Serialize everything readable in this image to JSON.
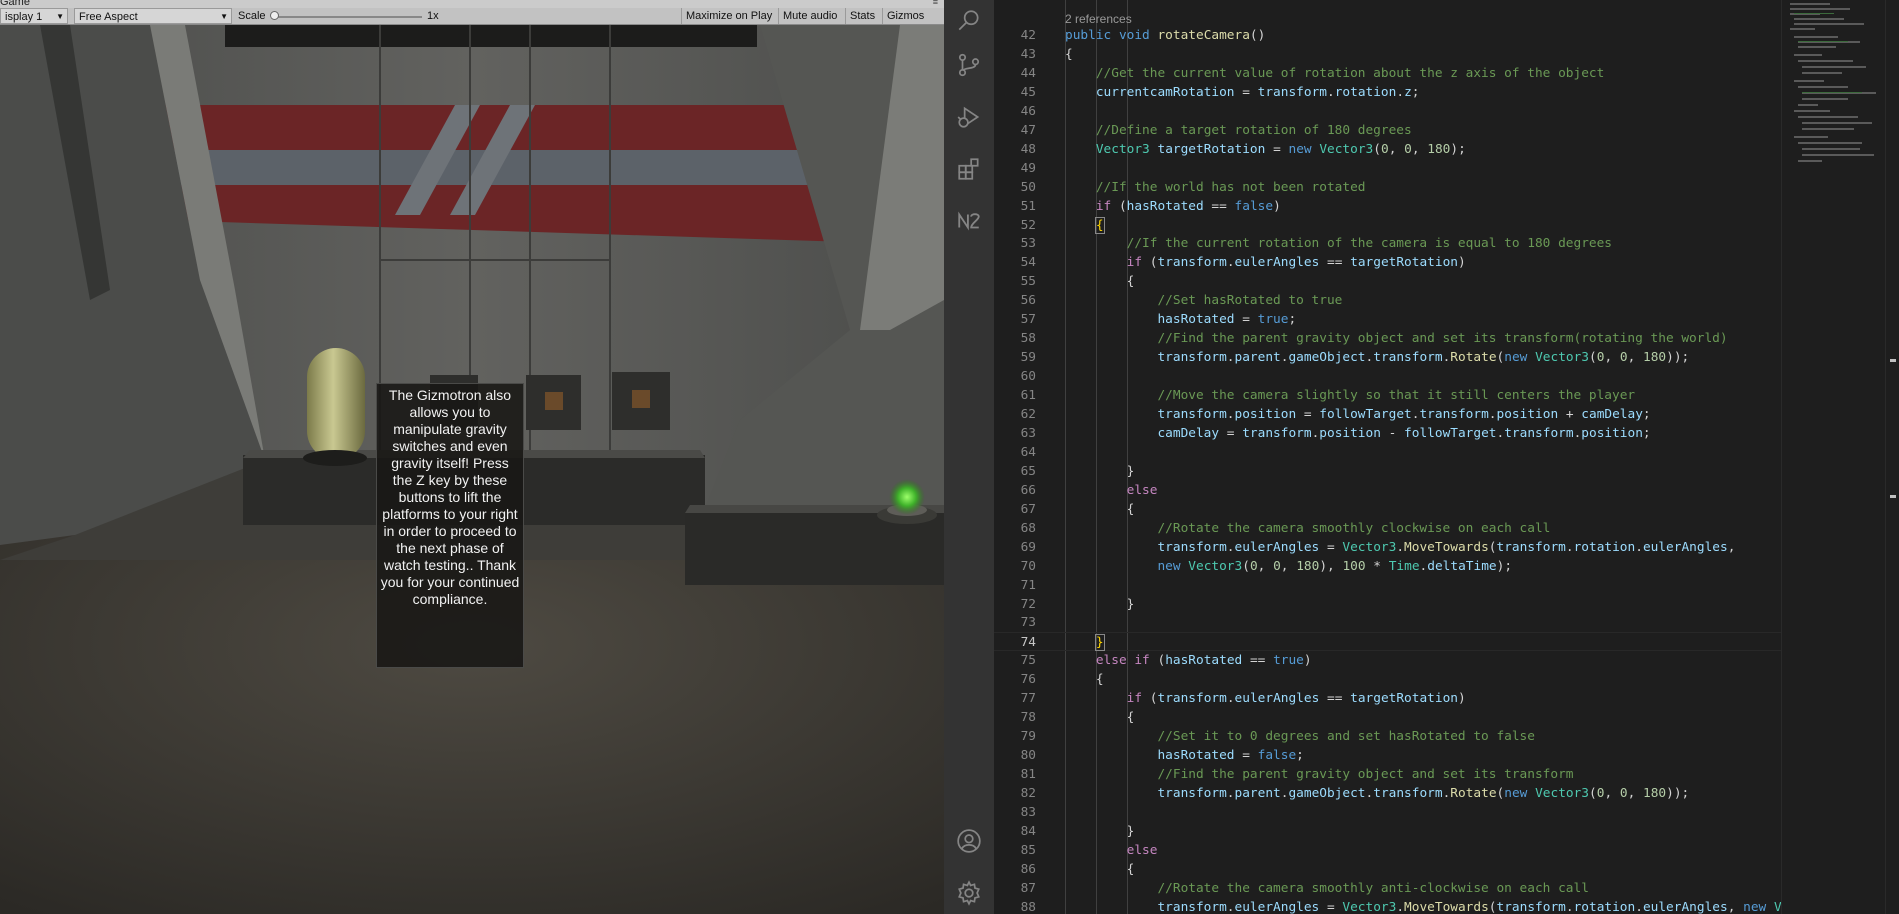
{
  "game_view": {
    "tab_title": "Game",
    "display_label": "isplay 1",
    "aspect_label": "Free Aspect",
    "scale_label": "Scale",
    "scale_value": "1x",
    "scale_level": 0.0,
    "buttons": [
      "Maximize on Play",
      "Mute audio",
      "Stats",
      "Gizmos"
    ],
    "tooltip_text": "The Gizmotron also allows you to manipulate gravity switches and even gravity itself! Press the Z key by these buttons to lift the platforms to your right in order to proceed to the next phase of watch testing.. Thank you for your continued compliance."
  },
  "activity_bar": {
    "icons": [
      "search-icon",
      "source-control-icon",
      "run-debug-icon",
      "extensions-icon",
      "n2-icon",
      "account-icon",
      "settings-gear-icon"
    ]
  },
  "editor": {
    "codelens": "2 references",
    "colors": {
      "comment": "#6a9955",
      "keyword": "#569cd6",
      "control": "#c586c0",
      "type": "#4ec9b0",
      "function": "#dcdcaa",
      "variable": "#9cdcfe",
      "number": "#b5cea8",
      "text": "#d4d4d4"
    },
    "lines": [
      {
        "num": "42",
        "tokens": [
          [
            "keyword",
            "public "
          ],
          [
            "keyword",
            "void "
          ],
          [
            "func",
            "rotateCamera"
          ],
          [
            "plain",
            "()"
          ]
        ]
      },
      {
        "num": "43",
        "tokens": [
          [
            "plain",
            "{"
          ]
        ]
      },
      {
        "num": "44",
        "tokens": [
          [
            "plain",
            "    "
          ],
          [
            "comment",
            "//Get the current value of rotation about the z axis of the object"
          ]
        ]
      },
      {
        "num": "45",
        "tokens": [
          [
            "plain",
            "    "
          ],
          [
            "var",
            "currentcamRotation"
          ],
          [
            "plain",
            " = "
          ],
          [
            "var",
            "transform"
          ],
          [
            "plain",
            "."
          ],
          [
            "var",
            "rotation"
          ],
          [
            "plain",
            "."
          ],
          [
            "var",
            "z"
          ],
          [
            "plain",
            ";"
          ]
        ]
      },
      {
        "num": "46",
        "tokens": []
      },
      {
        "num": "47",
        "tokens": [
          [
            "plain",
            "    "
          ],
          [
            "comment",
            "//Define a target rotation of 180 degrees"
          ]
        ]
      },
      {
        "num": "48",
        "tokens": [
          [
            "plain",
            "    "
          ],
          [
            "type",
            "Vector3"
          ],
          [
            "plain",
            " "
          ],
          [
            "var",
            "targetRotation"
          ],
          [
            "plain",
            " = "
          ],
          [
            "keyword",
            "new "
          ],
          [
            "type",
            "Vector3"
          ],
          [
            "plain",
            "("
          ],
          [
            "num",
            "0"
          ],
          [
            "plain",
            ", "
          ],
          [
            "num",
            "0"
          ],
          [
            "plain",
            ", "
          ],
          [
            "num",
            "180"
          ],
          [
            "plain",
            ");"
          ]
        ]
      },
      {
        "num": "49",
        "tokens": []
      },
      {
        "num": "50",
        "tokens": [
          [
            "plain",
            "    "
          ],
          [
            "comment",
            "//If the world has not been rotated"
          ]
        ]
      },
      {
        "num": "51",
        "tokens": [
          [
            "plain",
            "    "
          ],
          [
            "control",
            "if "
          ],
          [
            "plain",
            "("
          ],
          [
            "var",
            "hasRotated"
          ],
          [
            "plain",
            " == "
          ],
          [
            "keyword",
            "false"
          ],
          [
            "plain",
            ")"
          ]
        ]
      },
      {
        "num": "52",
        "tokens": [
          [
            "plain",
            "    "
          ],
          [
            "bm",
            "{"
          ]
        ]
      },
      {
        "num": "53",
        "tokens": [
          [
            "plain",
            "        "
          ],
          [
            "comment",
            "//If the current rotation of the camera is equal to 180 degrees"
          ]
        ]
      },
      {
        "num": "54",
        "tokens": [
          [
            "plain",
            "        "
          ],
          [
            "control",
            "if "
          ],
          [
            "plain",
            "("
          ],
          [
            "var",
            "transform"
          ],
          [
            "plain",
            "."
          ],
          [
            "var",
            "eulerAngles"
          ],
          [
            "plain",
            " == "
          ],
          [
            "var",
            "targetRotation"
          ],
          [
            "plain",
            ")"
          ]
        ]
      },
      {
        "num": "55",
        "tokens": [
          [
            "plain",
            "        {"
          ]
        ]
      },
      {
        "num": "56",
        "tokens": [
          [
            "plain",
            "            "
          ],
          [
            "comment",
            "//Set hasRotated to true"
          ]
        ]
      },
      {
        "num": "57",
        "tokens": [
          [
            "plain",
            "            "
          ],
          [
            "var",
            "hasRotated"
          ],
          [
            "plain",
            " = "
          ],
          [
            "keyword",
            "true"
          ],
          [
            "plain",
            ";"
          ]
        ]
      },
      {
        "num": "58",
        "tokens": [
          [
            "plain",
            "            "
          ],
          [
            "comment",
            "//Find the parent gravity object and set its transform(rotating the world)"
          ]
        ]
      },
      {
        "num": "59",
        "tokens": [
          [
            "plain",
            "            "
          ],
          [
            "var",
            "transform"
          ],
          [
            "plain",
            "."
          ],
          [
            "var",
            "parent"
          ],
          [
            "plain",
            "."
          ],
          [
            "var",
            "gameObject"
          ],
          [
            "plain",
            "."
          ],
          [
            "var",
            "transform"
          ],
          [
            "plain",
            "."
          ],
          [
            "func",
            "Rotate"
          ],
          [
            "plain",
            "("
          ],
          [
            "keyword",
            "new "
          ],
          [
            "type",
            "Vector3"
          ],
          [
            "plain",
            "("
          ],
          [
            "num",
            "0"
          ],
          [
            "plain",
            ", "
          ],
          [
            "num",
            "0"
          ],
          [
            "plain",
            ", "
          ],
          [
            "num",
            "180"
          ],
          [
            "plain",
            "));"
          ]
        ]
      },
      {
        "num": "60",
        "tokens": []
      },
      {
        "num": "61",
        "tokens": [
          [
            "plain",
            "            "
          ],
          [
            "comment",
            "//Move the camera slightly so that it still centers the player"
          ]
        ]
      },
      {
        "num": "62",
        "tokens": [
          [
            "plain",
            "            "
          ],
          [
            "var",
            "transform"
          ],
          [
            "plain",
            "."
          ],
          [
            "var",
            "position"
          ],
          [
            "plain",
            " = "
          ],
          [
            "var",
            "followTarget"
          ],
          [
            "plain",
            "."
          ],
          [
            "var",
            "transform"
          ],
          [
            "plain",
            "."
          ],
          [
            "var",
            "position"
          ],
          [
            "plain",
            " + "
          ],
          [
            "var",
            "camDelay"
          ],
          [
            "plain",
            ";"
          ]
        ]
      },
      {
        "num": "63",
        "tokens": [
          [
            "plain",
            "            "
          ],
          [
            "var",
            "camDelay"
          ],
          [
            "plain",
            " = "
          ],
          [
            "var",
            "transform"
          ],
          [
            "plain",
            "."
          ],
          [
            "var",
            "position"
          ],
          [
            "plain",
            " - "
          ],
          [
            "var",
            "followTarget"
          ],
          [
            "plain",
            "."
          ],
          [
            "var",
            "transform"
          ],
          [
            "plain",
            "."
          ],
          [
            "var",
            "position"
          ],
          [
            "plain",
            ";"
          ]
        ]
      },
      {
        "num": "64",
        "tokens": []
      },
      {
        "num": "65",
        "tokens": [
          [
            "plain",
            "        }"
          ]
        ]
      },
      {
        "num": "66",
        "tokens": [
          [
            "plain",
            "        "
          ],
          [
            "control",
            "else"
          ]
        ]
      },
      {
        "num": "67",
        "tokens": [
          [
            "plain",
            "        {"
          ]
        ]
      },
      {
        "num": "68",
        "tokens": [
          [
            "plain",
            "            "
          ],
          [
            "comment",
            "//Rotate the camera smoothly clockwise on each call"
          ]
        ]
      },
      {
        "num": "69",
        "tokens": [
          [
            "plain",
            "            "
          ],
          [
            "var",
            "transform"
          ],
          [
            "plain",
            "."
          ],
          [
            "var",
            "eulerAngles"
          ],
          [
            "plain",
            " = "
          ],
          [
            "type",
            "Vector3"
          ],
          [
            "plain",
            "."
          ],
          [
            "func",
            "MoveTowards"
          ],
          [
            "plain",
            "("
          ],
          [
            "var",
            "transform"
          ],
          [
            "plain",
            "."
          ],
          [
            "var",
            "rotation"
          ],
          [
            "plain",
            "."
          ],
          [
            "var",
            "eulerAngles"
          ],
          [
            "plain",
            ","
          ]
        ]
      },
      {
        "num": "70",
        "tokens": [
          [
            "plain",
            "            "
          ],
          [
            "keyword",
            "new "
          ],
          [
            "type",
            "Vector3"
          ],
          [
            "plain",
            "("
          ],
          [
            "num",
            "0"
          ],
          [
            "plain",
            ", "
          ],
          [
            "num",
            "0"
          ],
          [
            "plain",
            ", "
          ],
          [
            "num",
            "180"
          ],
          [
            "plain",
            "), "
          ],
          [
            "num",
            "100"
          ],
          [
            "plain",
            " * "
          ],
          [
            "type",
            "Time"
          ],
          [
            "plain",
            "."
          ],
          [
            "var",
            "deltaTime"
          ],
          [
            "plain",
            ");"
          ]
        ]
      },
      {
        "num": "71",
        "tokens": []
      },
      {
        "num": "72",
        "tokens": [
          [
            "plain",
            "        }"
          ]
        ]
      },
      {
        "num": "73",
        "tokens": []
      },
      {
        "num": "74",
        "tokens": [
          [
            "plain",
            "    "
          ],
          [
            "bm",
            "}"
          ]
        ]
      },
      {
        "num": "75",
        "tokens": [
          [
            "plain",
            "    "
          ],
          [
            "control",
            "else if "
          ],
          [
            "plain",
            "("
          ],
          [
            "var",
            "hasRotated"
          ],
          [
            "plain",
            " == "
          ],
          [
            "keyword",
            "true"
          ],
          [
            "plain",
            ")"
          ]
        ]
      },
      {
        "num": "76",
        "tokens": [
          [
            "plain",
            "    {"
          ]
        ]
      },
      {
        "num": "77",
        "tokens": [
          [
            "plain",
            "        "
          ],
          [
            "control",
            "if "
          ],
          [
            "plain",
            "("
          ],
          [
            "var",
            "transform"
          ],
          [
            "plain",
            "."
          ],
          [
            "var",
            "eulerAngles"
          ],
          [
            "plain",
            " == "
          ],
          [
            "var",
            "targetRotation"
          ],
          [
            "plain",
            ")"
          ]
        ]
      },
      {
        "num": "78",
        "tokens": [
          [
            "plain",
            "        {"
          ]
        ]
      },
      {
        "num": "79",
        "tokens": [
          [
            "plain",
            "            "
          ],
          [
            "comment",
            "//Set it to 0 degrees and set hasRotated to false"
          ]
        ]
      },
      {
        "num": "80",
        "tokens": [
          [
            "plain",
            "            "
          ],
          [
            "var",
            "hasRotated"
          ],
          [
            "plain",
            " = "
          ],
          [
            "keyword",
            "false"
          ],
          [
            "plain",
            ";"
          ]
        ]
      },
      {
        "num": "81",
        "tokens": [
          [
            "plain",
            "            "
          ],
          [
            "comment",
            "//Find the parent gravity object and set its transform"
          ]
        ]
      },
      {
        "num": "82",
        "tokens": [
          [
            "plain",
            "            "
          ],
          [
            "var",
            "transform"
          ],
          [
            "plain",
            "."
          ],
          [
            "var",
            "parent"
          ],
          [
            "plain",
            "."
          ],
          [
            "var",
            "gameObject"
          ],
          [
            "plain",
            "."
          ],
          [
            "var",
            "transform"
          ],
          [
            "plain",
            "."
          ],
          [
            "func",
            "Rotate"
          ],
          [
            "plain",
            "("
          ],
          [
            "keyword",
            "new "
          ],
          [
            "type",
            "Vector3"
          ],
          [
            "plain",
            "("
          ],
          [
            "num",
            "0"
          ],
          [
            "plain",
            ", "
          ],
          [
            "num",
            "0"
          ],
          [
            "plain",
            ", "
          ],
          [
            "num",
            "180"
          ],
          [
            "plain",
            "));"
          ]
        ]
      },
      {
        "num": "83",
        "tokens": []
      },
      {
        "num": "84",
        "tokens": [
          [
            "plain",
            "        }"
          ]
        ]
      },
      {
        "num": "85",
        "tokens": [
          [
            "plain",
            "        "
          ],
          [
            "control",
            "else"
          ]
        ]
      },
      {
        "num": "86",
        "tokens": [
          [
            "plain",
            "        {"
          ]
        ]
      },
      {
        "num": "87",
        "tokens": [
          [
            "plain",
            "            "
          ],
          [
            "comment",
            "//Rotate the camera smoothly anti-clockwise on each call"
          ]
        ]
      },
      {
        "num": "88",
        "tokens": [
          [
            "plain",
            "            "
          ],
          [
            "var",
            "transform"
          ],
          [
            "plain",
            "."
          ],
          [
            "var",
            "eulerAngles"
          ],
          [
            "plain",
            " = "
          ],
          [
            "type",
            "Vector3"
          ],
          [
            "plain",
            "."
          ],
          [
            "func",
            "MoveTowards"
          ],
          [
            "plain",
            "("
          ],
          [
            "var",
            "transform"
          ],
          [
            "plain",
            "."
          ],
          [
            "var",
            "rotation"
          ],
          [
            "plain",
            "."
          ],
          [
            "var",
            "eulerAngles"
          ],
          [
            "plain",
            ", "
          ],
          [
            "keyword",
            "new "
          ],
          [
            "type",
            "Ve"
          ]
        ]
      }
    ]
  }
}
